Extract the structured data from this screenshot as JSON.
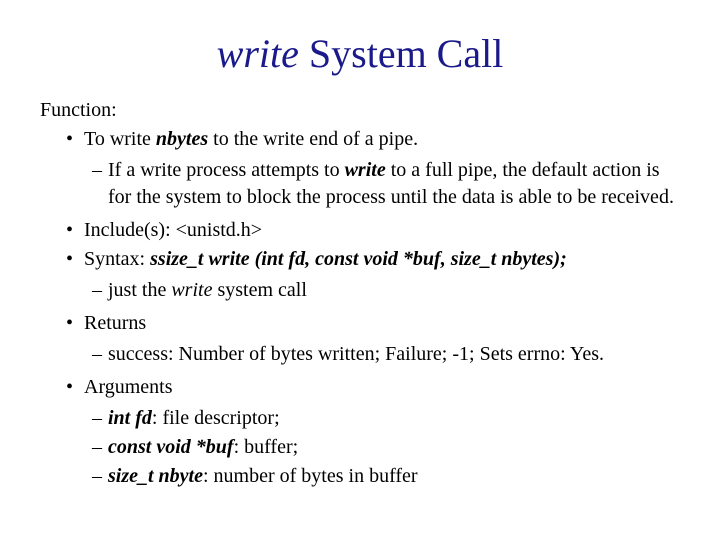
{
  "title": {
    "ital": "write",
    "rest": " System Call"
  },
  "function_label": "Function:",
  "bullet1": {
    "pre": "To write ",
    "nbytes": "nbytes",
    "post": "  to the write end of a pipe."
  },
  "sub1": {
    "a": "If a write process attempts to ",
    "w": "write",
    "b": " to a full pipe, the default action is for the system to block the process until the data is able to be received."
  },
  "include_line": "Include(s):  <unistd.h>",
  "syntax": {
    "pre": "Syntax:  ",
    "code": "ssize_t write (int fd, const void *buf, size_t  nbytes);"
  },
  "sub2": {
    "a": "just the ",
    "w": "write",
    "b": " system call"
  },
  "returns_label": "Returns",
  "returns_sub": "success: Number of bytes written; Failure; -1; Sets errno: Yes.",
  "args_label": "Arguments",
  "arg1": {
    "k": "int fd",
    "v": ": file descriptor;"
  },
  "arg2": {
    "k": "const void *buf",
    "v": ": buffer;"
  },
  "arg3": {
    "k": "size_t nbyte",
    "v": ": number of bytes in buffer"
  }
}
